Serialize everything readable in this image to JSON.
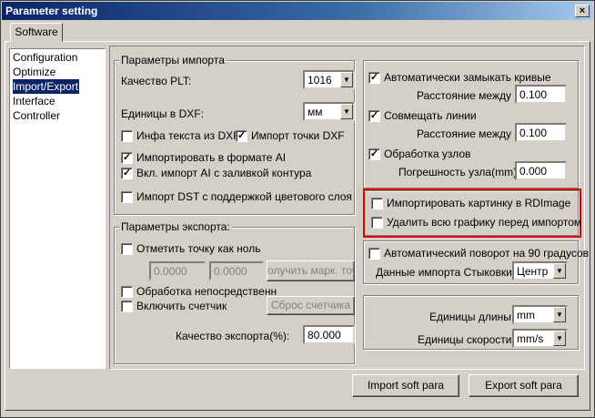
{
  "window": {
    "title": "Parameter setting",
    "close": "×"
  },
  "tab": "Software",
  "sidebar": {
    "items": [
      "Configuration",
      "Optimize",
      "Import/Export",
      "Interface",
      "Controller"
    ]
  },
  "import": {
    "group_title": "Параметры импорта",
    "plt_quality_label": "Качество PLT:",
    "plt_quality_value": "1016",
    "dxf_units_label": "Единицы в DXF:",
    "dxf_units_value": "мм",
    "dxf_text_info": "Инфа текста из DXF",
    "dxf_text_info_checked": false,
    "dxf_import_point": "Импорт точки DXF",
    "dxf_import_point_checked": true,
    "ai_import": "Импортировать в формате AI",
    "ai_import_checked": true,
    "ai_fill": "Вкл. импорт AI с заливкой контура",
    "ai_fill_checked": true,
    "dst_import": "Импорт DST с поддержкой цветового слоя",
    "dst_import_checked": false
  },
  "export": {
    "group_title": "Параметры экспорта:",
    "zero_point": "Отметить точку как ноль",
    "zero_point_checked": false,
    "x_value": "0.0000",
    "y_value": "0.0000",
    "get_mark_button": "олучить марк. точк",
    "direct_process": "Обработка непосредственн",
    "direct_process_checked": false,
    "counter": "Включить счетчик",
    "counter_checked": false,
    "reset_counter_button": "Сброс счетчика",
    "quality_label": "Качество экспорта(%):",
    "quality_value": "80.000"
  },
  "right": {
    "auto_close": "Автоматически замыкать кривые",
    "auto_close_checked": true,
    "distance1_label": "Расстояние между",
    "distance1_value": "0.100",
    "merge_lines": "Совмещать линии",
    "merge_lines_checked": true,
    "distance2_label": "Расстояние между",
    "distance2_value": "0.100",
    "node_process": "Обработка узлов",
    "node_process_checked": true,
    "node_error_label": "Погрешность узла(mm):",
    "node_error_value": "0.000",
    "import_rdimage": "Импортировать картинку в RDImage",
    "import_rdimage_checked": false,
    "delete_graphics": "Удалить всю графику перед импортом",
    "delete_graphics_checked": false,
    "auto_rotate": "Автоматический поворот на 90 градусов",
    "auto_rotate_checked": false,
    "dock_label": "Данные импорта Стыковки:",
    "dock_value": "Центр",
    "length_units_label": "Единицы длины:",
    "length_units_value": "mm",
    "speed_units_label": "Единицы скорости:",
    "speed_units_value": "mm/s"
  },
  "buttons": {
    "import_para": "Import soft para",
    "export_para": "Export soft para"
  },
  "colors": {
    "highlight": "#e00000",
    "title_bar": "#0a246a",
    "selection": "#0a246a"
  }
}
